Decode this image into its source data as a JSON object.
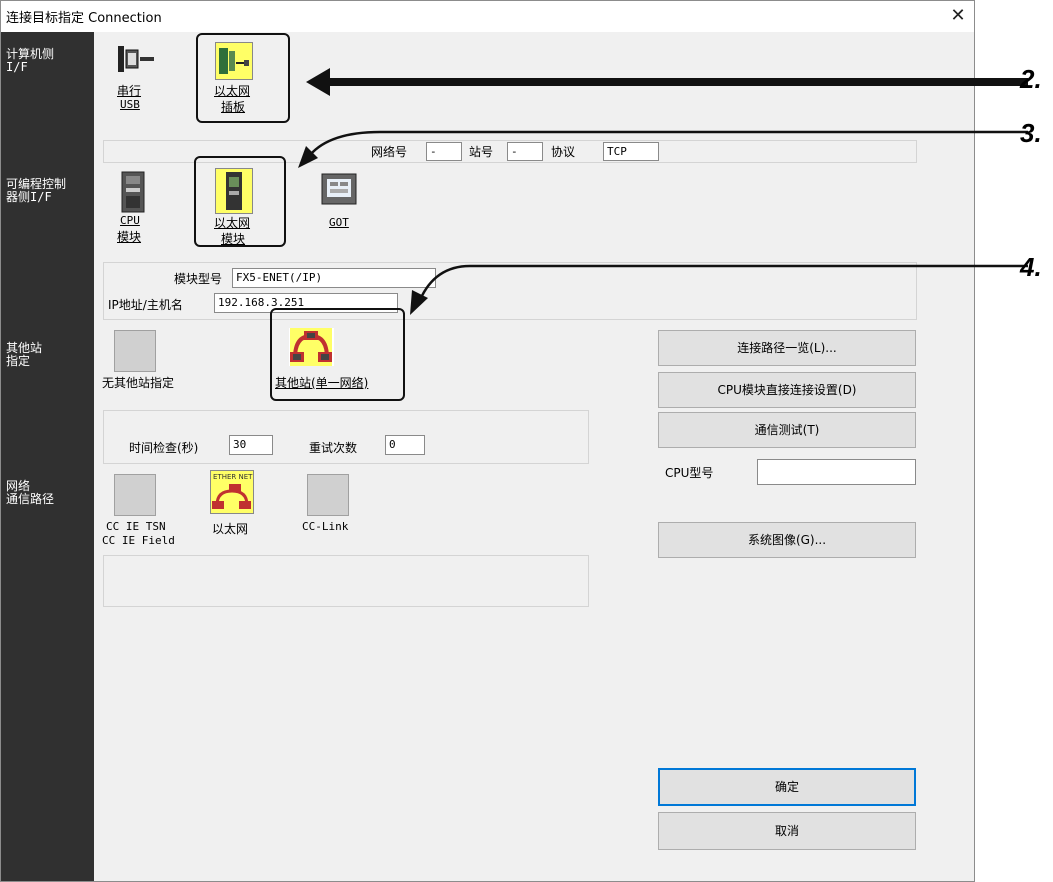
{
  "dialog": {
    "title": "连接目标指定 Connection",
    "close_glyph": "✕"
  },
  "sidebar": {
    "pc_if": "计算机侧\nI/F",
    "plc_if": "可编程控制\n器侧I/F",
    "other_station": "其他站\n指定",
    "network_route": "网络\n通信路径"
  },
  "pc_side": {
    "serial": {
      "line1": "串行",
      "line2": "USB"
    },
    "ethernet_board": {
      "line1": "以太网",
      "line2": "插板"
    }
  },
  "network_info": {
    "network_no_label": "网络号",
    "network_no_value": "-",
    "station_no_label": "站号",
    "station_no_value": "-",
    "protocol_label": "协议",
    "protocol_value": "TCP"
  },
  "plc_side": {
    "cpu_module": {
      "line1": "CPU",
      "line2": "模块"
    },
    "ethernet_module": {
      "line1": "以太网",
      "line2": "模块"
    },
    "got": {
      "label": "GOT"
    }
  },
  "module_info": {
    "model_label": "模块型号",
    "model_value": "FX5-ENET(/IP)",
    "ip_label": "IP地址/主机名",
    "ip_value": "192.168.3.251"
  },
  "other_station": {
    "none_label": "无其他站指定",
    "single_network_label": "其他站(单一网络)"
  },
  "timing": {
    "time_check_label": "时间检查(秒)",
    "time_check_value": "30",
    "retry_label": "重试次数",
    "retry_value": "0"
  },
  "network_route": {
    "cc_ie": {
      "line1": "CC IE TSN",
      "line2": "CC IE Field"
    },
    "ethernet": {
      "label": "以太网",
      "icon_text": "ETHER NET"
    },
    "cc_link": {
      "label": "CC-Link"
    }
  },
  "buttons": {
    "route_list": "连接路径一览(L)...",
    "cpu_direct": "CPU模块直接连接设置(D)",
    "comm_test": "通信测试(T)",
    "system_image": "系统图像(G)...",
    "ok": "确定",
    "cancel": "取消"
  },
  "cpu_type": {
    "label": "CPU型号",
    "value": ""
  },
  "callouts": {
    "c2": "2.",
    "c3": "3.",
    "c4": "4."
  }
}
